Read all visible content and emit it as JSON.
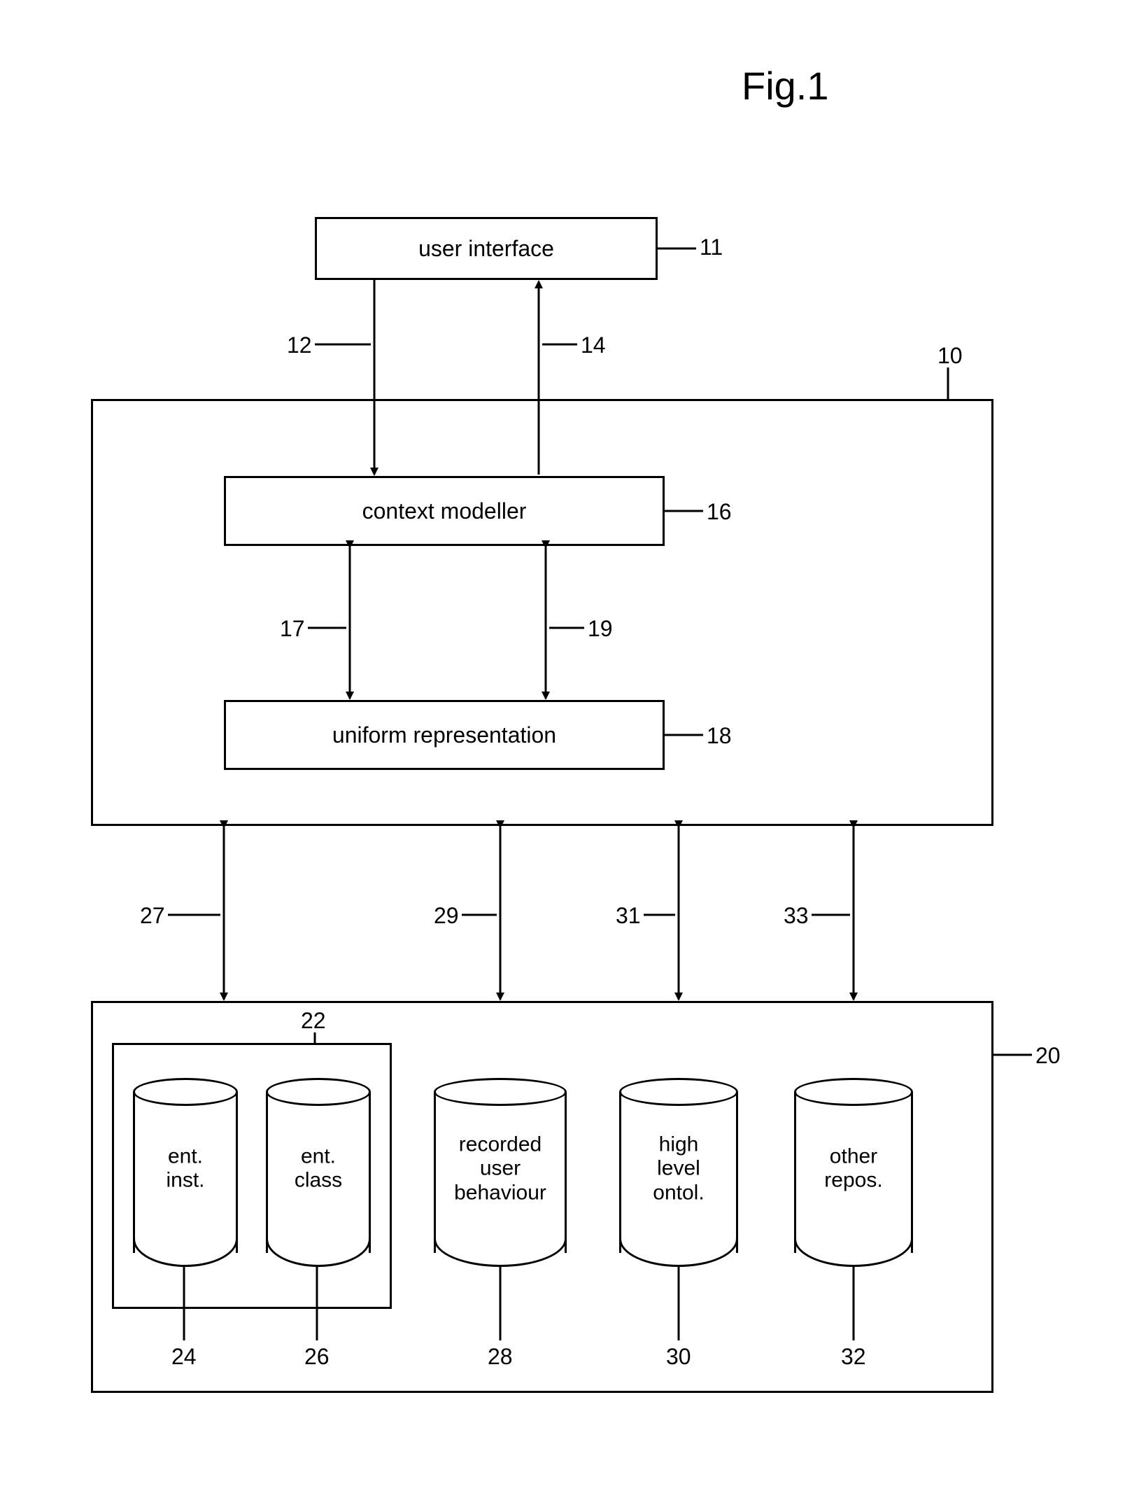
{
  "title": "Fig.1",
  "blocks": {
    "user_interface": "user interface",
    "context_modeller": "context modeller",
    "uniform_representation": "uniform representation"
  },
  "cylinders": {
    "ent_inst": "ent.\ninst.",
    "ent_class": "ent.\nclass",
    "recorded_user_behaviour": "recorded\nuser\nbehaviour",
    "high_level_ontol": "high\nlevel\nontol.",
    "other_repos": "other\nrepos."
  },
  "refs": {
    "r10": "10",
    "r11": "11",
    "r12": "12",
    "r14": "14",
    "r16": "16",
    "r17": "17",
    "r18": "18",
    "r19": "19",
    "r20": "20",
    "r22": "22",
    "r24": "24",
    "r26": "26",
    "r27": "27",
    "r28": "28",
    "r29": "29",
    "r30": "30",
    "r31": "31",
    "r32": "32",
    "r33": "33"
  }
}
